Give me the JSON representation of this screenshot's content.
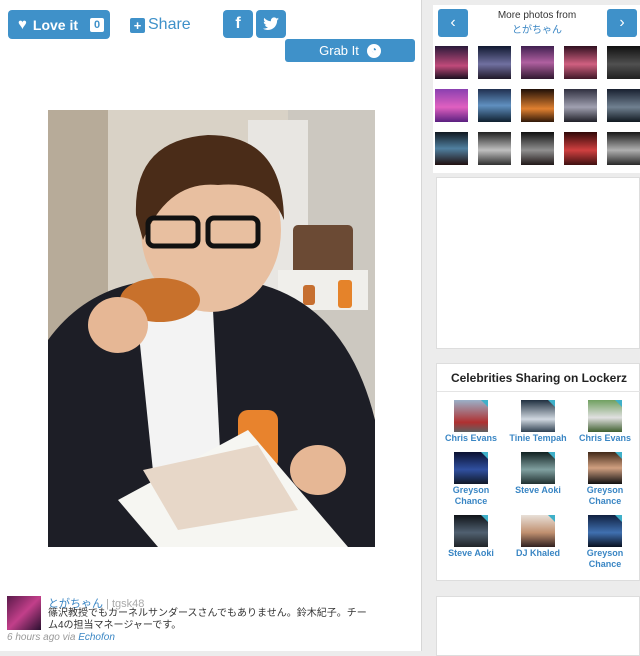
{
  "actions": {
    "love_label": "Love it",
    "love_count": "0",
    "share_label": "Share",
    "facebook_glyph": "f",
    "twitter_glyph": "t",
    "grab_label": "Grab It"
  },
  "tweet": {
    "user": "とがちゃん",
    "separator": "|",
    "handle": "tgsk48",
    "text": "篠沢教授でもカーネルサンダースさんでもありません。鈴木紀子。チーム4の担当マネージャーです。",
    "time": "6 hours ago",
    "via_prefix": "via",
    "via_app": "Echofon"
  },
  "more_photos": {
    "title": "More photos from",
    "user": "とがちゃん",
    "prev_icon": "chevron-left-icon",
    "next_icon": "chevron-right-icon"
  },
  "celebrities": {
    "title": "Celebrities Sharing on Lockerz",
    "items": [
      {
        "name": "Chris Evans"
      },
      {
        "name": "Tinie Tempah"
      },
      {
        "name": "Chris Evans"
      },
      {
        "name": "Greyson Chance"
      },
      {
        "name": "Steve Aoki"
      },
      {
        "name": "Greyson Chance"
      },
      {
        "name": "Steve Aoki"
      },
      {
        "name": "DJ Khaled"
      },
      {
        "name": "Greyson Chance"
      }
    ]
  },
  "colors": {
    "accent": "#3f91c9",
    "link": "#3a86c4"
  }
}
